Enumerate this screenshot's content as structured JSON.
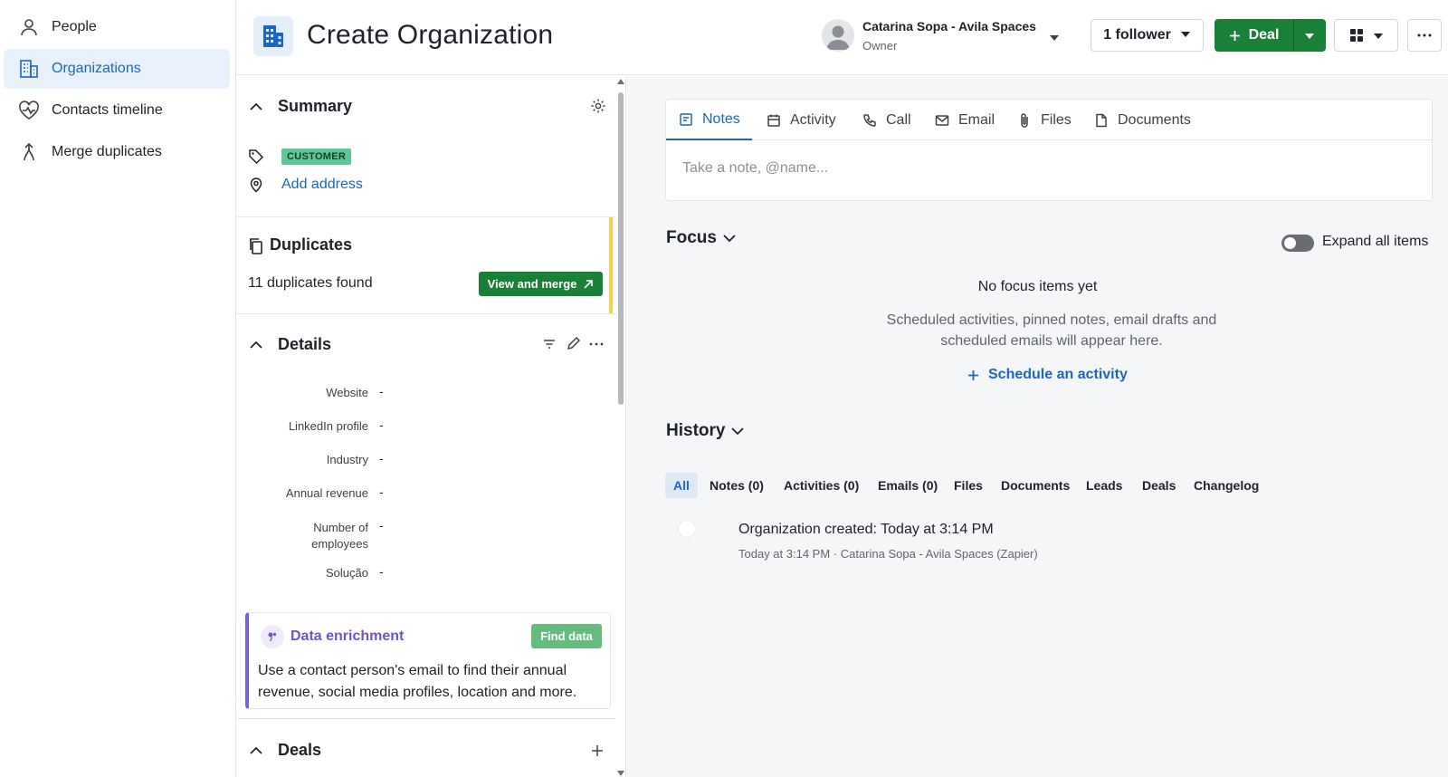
{
  "nav": {
    "items": [
      {
        "label": "People",
        "icon": "person-icon",
        "active": false
      },
      {
        "label": "Organizations",
        "icon": "building-icon",
        "active": true
      },
      {
        "label": "Contacts timeline",
        "icon": "heart-pulse-icon",
        "active": false
      },
      {
        "label": "Merge duplicates",
        "icon": "merge-icon",
        "active": false
      }
    ]
  },
  "header": {
    "title": "Create Organization",
    "owner_name": "Catarina Sopa - Avila Spaces",
    "owner_role": "Owner",
    "follower_label": "1 follower",
    "deal_label": "Deal"
  },
  "summary": {
    "title": "Summary",
    "badge": "CUSTOMER",
    "add_address": "Add address"
  },
  "duplicates": {
    "title": "Duplicates",
    "found_text": "11 duplicates found",
    "button": "View and merge"
  },
  "details": {
    "title": "Details",
    "fields": [
      {
        "label": "Website",
        "value": "-"
      },
      {
        "label": "LinkedIn profile",
        "value": "-"
      },
      {
        "label": "Industry",
        "value": "-"
      },
      {
        "label": "Annual revenue",
        "value": "-"
      },
      {
        "label": "Number of employees",
        "value": "-"
      },
      {
        "label": "Solução",
        "value": "-"
      }
    ]
  },
  "enrichment": {
    "title": "Data enrichment",
    "button": "Find data",
    "text": "Use a contact person's email to find their annual revenue, social media profiles, location and more."
  },
  "deals": {
    "title": "Deals"
  },
  "composer": {
    "tabs": [
      "Notes",
      "Activity",
      "Call",
      "Email",
      "Files",
      "Documents"
    ],
    "active_tab": "Notes",
    "placeholder": "Take a note, @name..."
  },
  "focus": {
    "title": "Focus",
    "expand_label": "Expand all items",
    "empty_title": "No focus items yet",
    "empty_text": "Scheduled activities, pinned notes, email drafts and scheduled emails will appear here.",
    "schedule_link": "Schedule an activity"
  },
  "history": {
    "title": "History",
    "filters": [
      "All",
      "Notes (0)",
      "Activities (0)",
      "Emails (0)",
      "Files",
      "Documents",
      "Leads",
      "Deals",
      "Changelog"
    ],
    "active_filter": "All",
    "event_title": "Organization created",
    "event_time": "Today at 3:14 PM",
    "event_sub": "Today at 3:14 PM · Catarina Sopa - Avila Spaces (Zapier)"
  },
  "colors": {
    "accent": "#1b66c4",
    "primary_green": "#1a7f37",
    "badge_green": "#5dc896",
    "warning_yellow": "#f6d14c",
    "enrich_purple": "#7b61d9"
  }
}
